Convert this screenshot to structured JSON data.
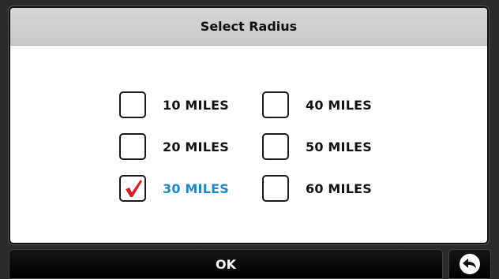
{
  "dialog": {
    "title": "Select Radius"
  },
  "options": [
    {
      "label": "10 MILES",
      "checked": false
    },
    {
      "label": "20 MILES",
      "checked": false
    },
    {
      "label": "30 MILES",
      "checked": true
    },
    {
      "label": "40 MILES",
      "checked": false
    },
    {
      "label": "50 MILES",
      "checked": false
    },
    {
      "label": "60 MILES",
      "checked": false
    }
  ],
  "footer": {
    "ok_label": "OK",
    "back_icon": "back-arrow-icon"
  },
  "colors": {
    "selected_text": "#1e86c2",
    "checkmark": "#d0202a",
    "header_bg": "#cdcdcd",
    "footer_bg": "#000000"
  }
}
